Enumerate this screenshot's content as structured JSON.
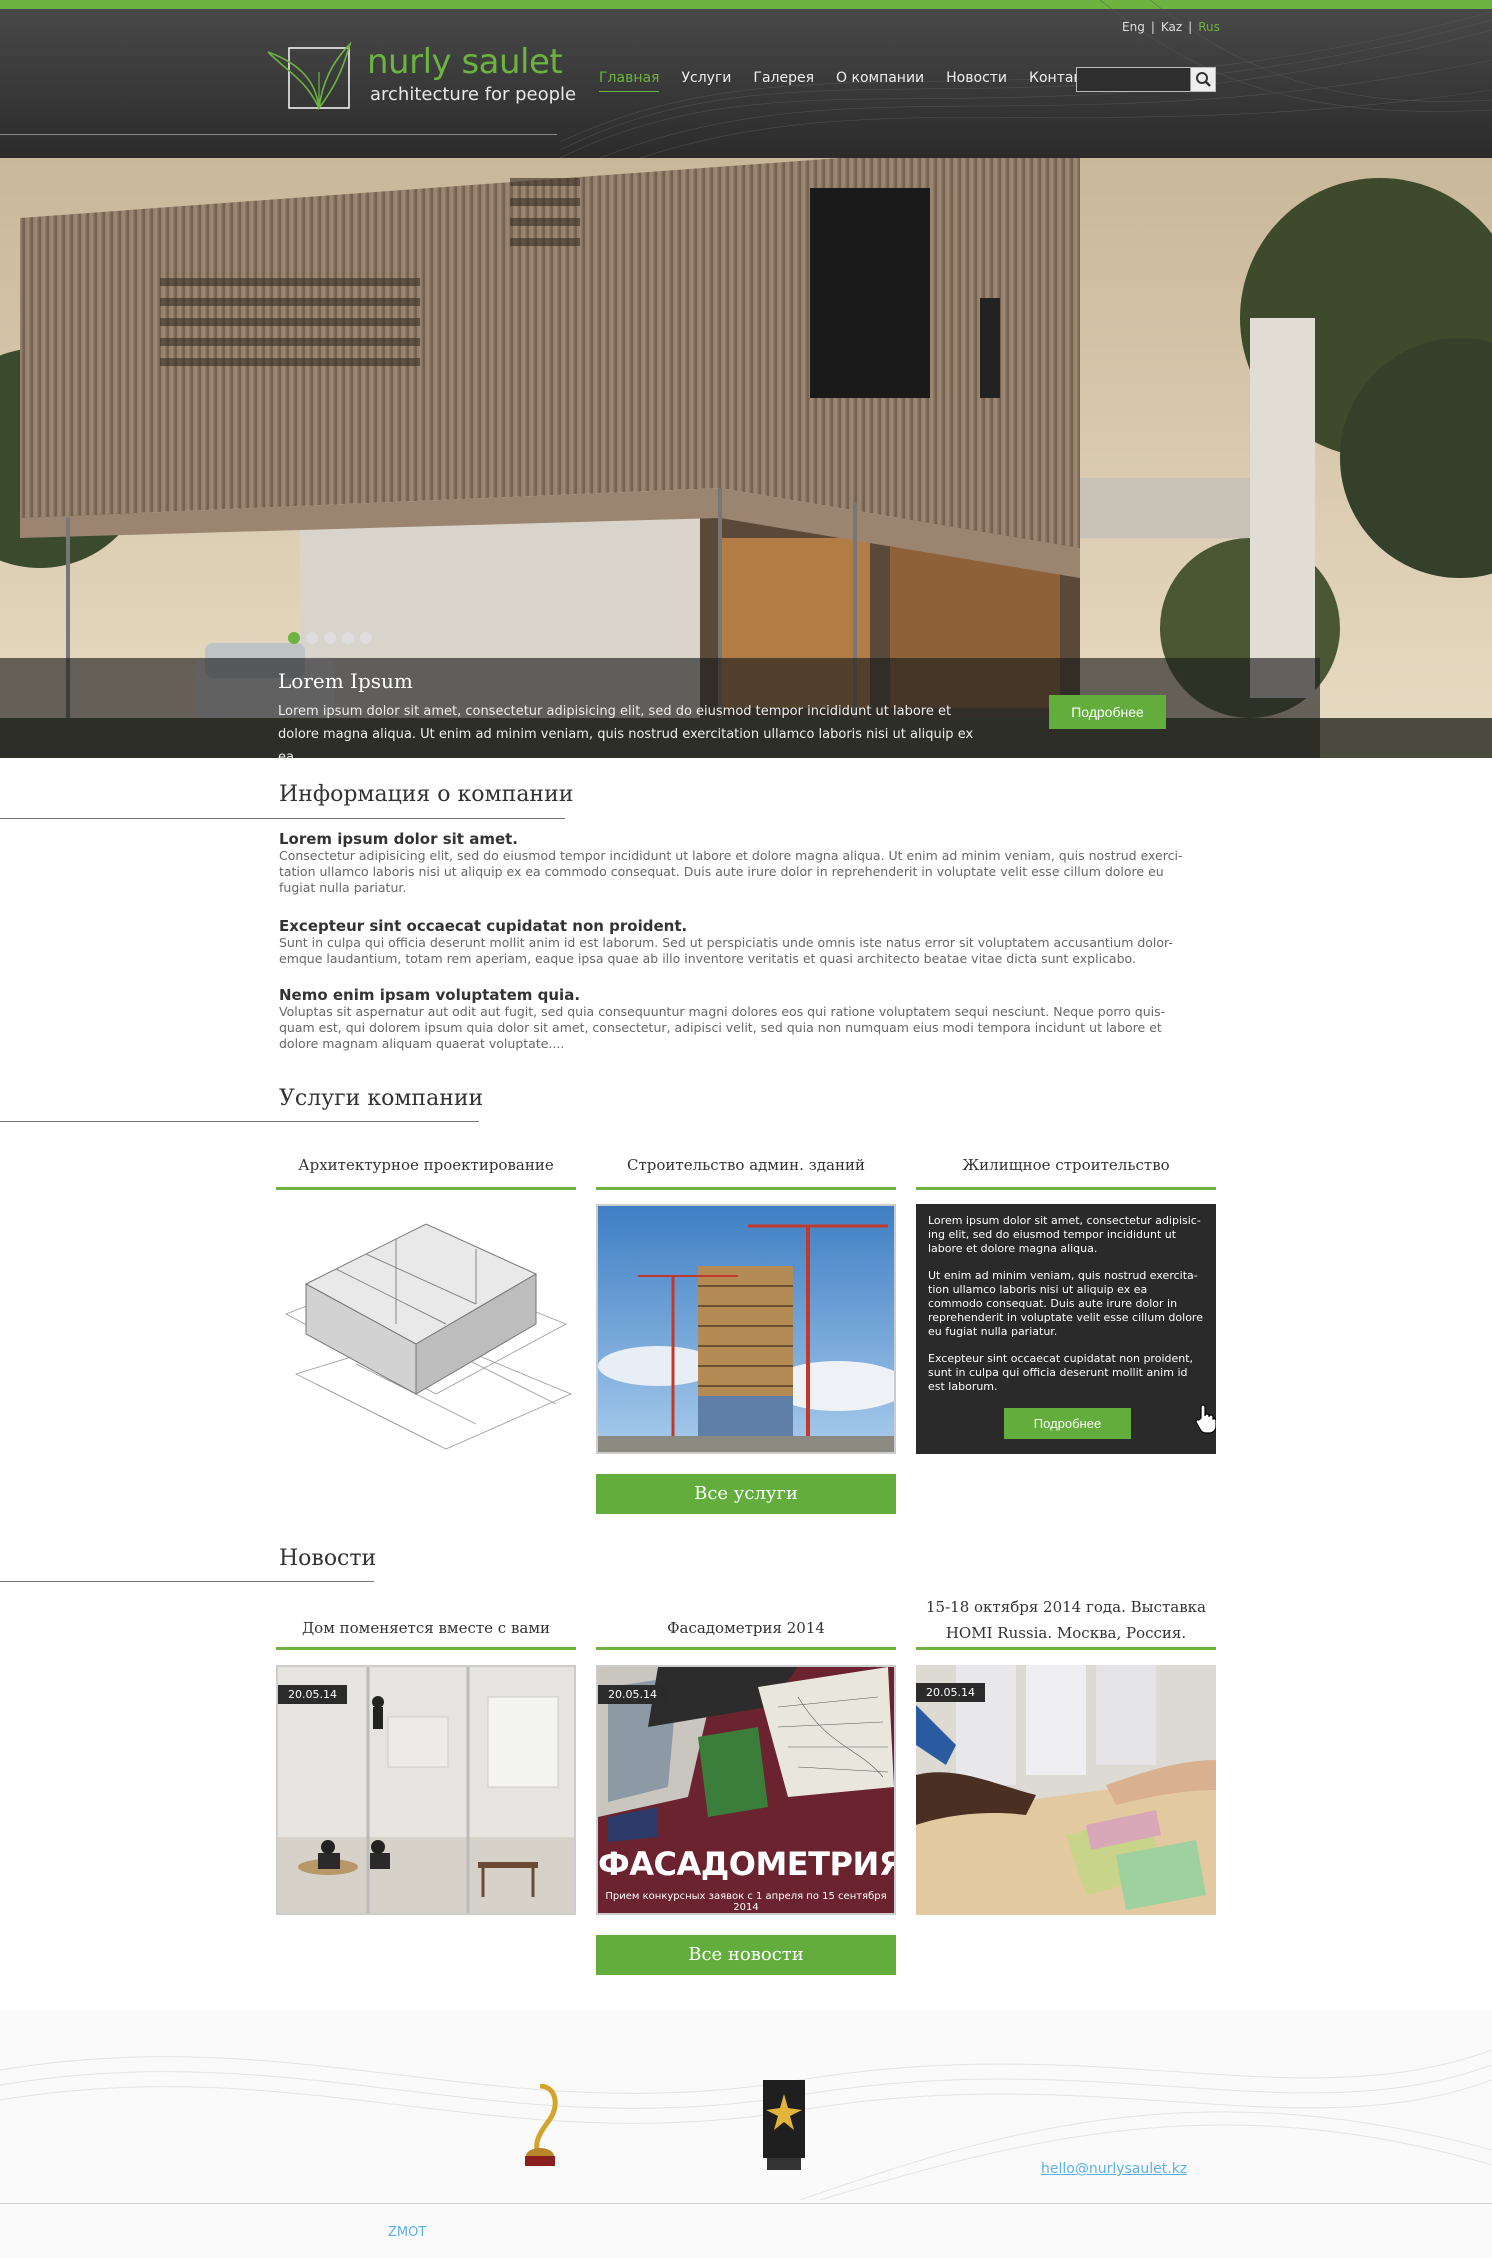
{
  "header": {
    "brand_name": "nurly saulet",
    "tagline": "architecture for people",
    "languages": [
      {
        "label": "Eng",
        "active": false
      },
      {
        "label": "Kaz",
        "active": false
      },
      {
        "label": "Rus",
        "active": true
      }
    ],
    "lang_separator": "|",
    "nav": [
      {
        "label": "Главная",
        "active": true
      },
      {
        "label": "Услуги",
        "active": false
      },
      {
        "label": "Галерея",
        "active": false
      },
      {
        "label": "О компании",
        "active": false
      },
      {
        "label": "Новости",
        "active": false
      },
      {
        "label": "Контакты",
        "active": false
      }
    ],
    "search": {
      "value": "",
      "placeholder": ""
    },
    "accent_color": "#6cb33f"
  },
  "hero": {
    "title": "Lorem Ipsum",
    "text": "Lorem ipsum dolor sit amet, consectetur adipisicing elit, sed do eiusmod tempor incididunt ut labore et dolore magna aliqua. Ut enim ad minim veniam, quis nostrud exercitation ullamco laboris nisi ut aliquip ex ea",
    "more_label": "Подробнее",
    "slide_count": 5,
    "active_slide": 1
  },
  "about": {
    "title": "Информация о компании",
    "blocks": [
      {
        "heading": "Lorem ipsum dolor sit amet.",
        "text": "Consectetur adipisicing elit, sed do eiusmod tempor incididunt ut labore et dolore magna aliqua. Ut enim ad minim veniam, quis nostrud exerci-tation ullamco laboris nisi ut aliquip ex ea commodo consequat. Duis aute irure dolor in reprehenderit in voluptate velit esse cillum dolore eu fugiat nulla pariatur."
      },
      {
        "heading": "Excepteur sint occaecat cupidatat non proident.",
        "text": "Sunt in culpa qui officia deserunt mollit anim id est laborum. Sed ut perspiciatis unde omnis iste natus error sit voluptatem accusantium dolor-emque laudantium, totam rem aperiam, eaque ipsa quae ab illo inventore veritatis et quasi architecto beatae vitae dicta sunt explicabo."
      },
      {
        "heading": "Nemo enim ipsam voluptatem quia.",
        "text": "Voluptas sit aspernatur aut odit aut fugit, sed quia consequuntur magni dolores eos qui ratione voluptatem sequi nesciunt. Neque porro quis-quam est, qui dolorem ipsum quia dolor sit amet, consectetur, adipisci velit, sed quia non numquam eius modi tempora incidunt ut labore et dolore magnam aliquam quaerat voluptate...."
      }
    ]
  },
  "services": {
    "title": "Услуги компании",
    "items": [
      {
        "title": "Архитектурное проектирование"
      },
      {
        "title": "Строительство админ. зданий"
      },
      {
        "title": "Жилищное строительство",
        "hover_text": [
          "Lorem ipsum dolor sit amet, consectetur adipisic-ing elit, sed do eiusmod tempor incididunt ut labore et dolore magna aliqua.",
          "Ut enim ad minim veniam, quis nostrud exercita-tion ullamco laboris nisi ut aliquip ex ea commodo consequat. Duis aute irure dolor in reprehenderit in voluptate velit esse cillum dolore eu fugiat nulla pariatur.",
          "Excepteur sint occaecat cupidatat non proident, sunt in culpa qui officia deserunt mollit anim id est laborum."
        ],
        "more_label": "Подробнее"
      }
    ],
    "all_label": "Все услуги"
  },
  "news": {
    "title": "Новости",
    "items": [
      {
        "title": "Дом поменяется вместе с вами",
        "date": "20.05.14"
      },
      {
        "title": "Фасадометрия 2014",
        "date": "20.05.14",
        "poster_title": "ФАСАДОМЕТРИЯ",
        "poster_sub": "Прием конкурсных заявок с 1 апреля по 15 сентября 2014"
      },
      {
        "title": "15-18 октября 2014 года. Выставка HOMI Russia. Москва, Россия.",
        "date": "20.05.14"
      }
    ],
    "all_label": "Все новости"
  },
  "footer": {
    "email": "hello@nurlysaulet.kz",
    "credit": "ZMOT"
  }
}
